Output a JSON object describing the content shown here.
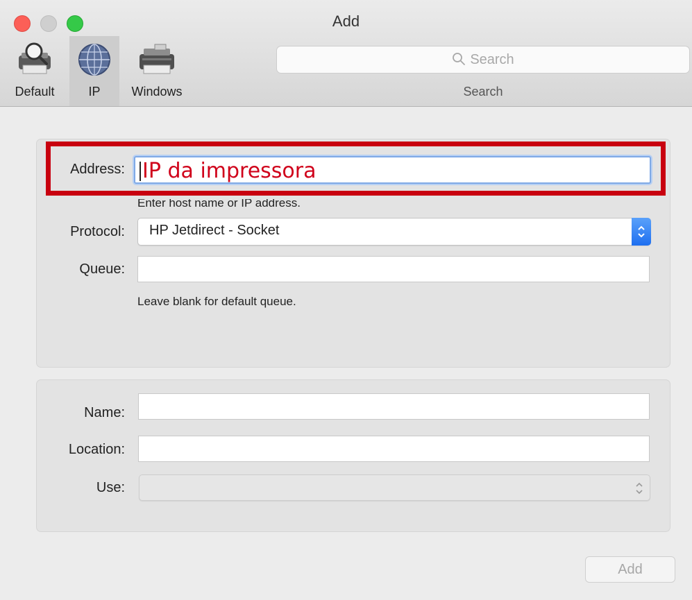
{
  "window": {
    "title": "Add"
  },
  "toolbar": {
    "items": [
      {
        "label": "Default",
        "icon": "printer-magnifier-icon"
      },
      {
        "label": "IP",
        "icon": "globe-icon",
        "selected": true
      },
      {
        "label": "Windows",
        "icon": "printer-icon"
      }
    ],
    "search": {
      "placeholder": "Search",
      "caption": "Search"
    }
  },
  "form": {
    "address": {
      "label": "Address:",
      "value": "IP da impressora",
      "hint": "Enter host name or IP address."
    },
    "protocol": {
      "label": "Protocol:",
      "value": "HP Jetdirect - Socket"
    },
    "queue": {
      "label": "Queue:",
      "value": "",
      "hint": "Leave blank for default queue."
    },
    "name": {
      "label": "Name:",
      "value": ""
    },
    "location": {
      "label": "Location:",
      "value": ""
    },
    "use": {
      "label": "Use:",
      "value": ""
    }
  },
  "buttons": {
    "add": "Add"
  },
  "colors": {
    "highlight": "#c8000f",
    "address_text": "#d0021b",
    "accent": "#1e6ff0"
  }
}
